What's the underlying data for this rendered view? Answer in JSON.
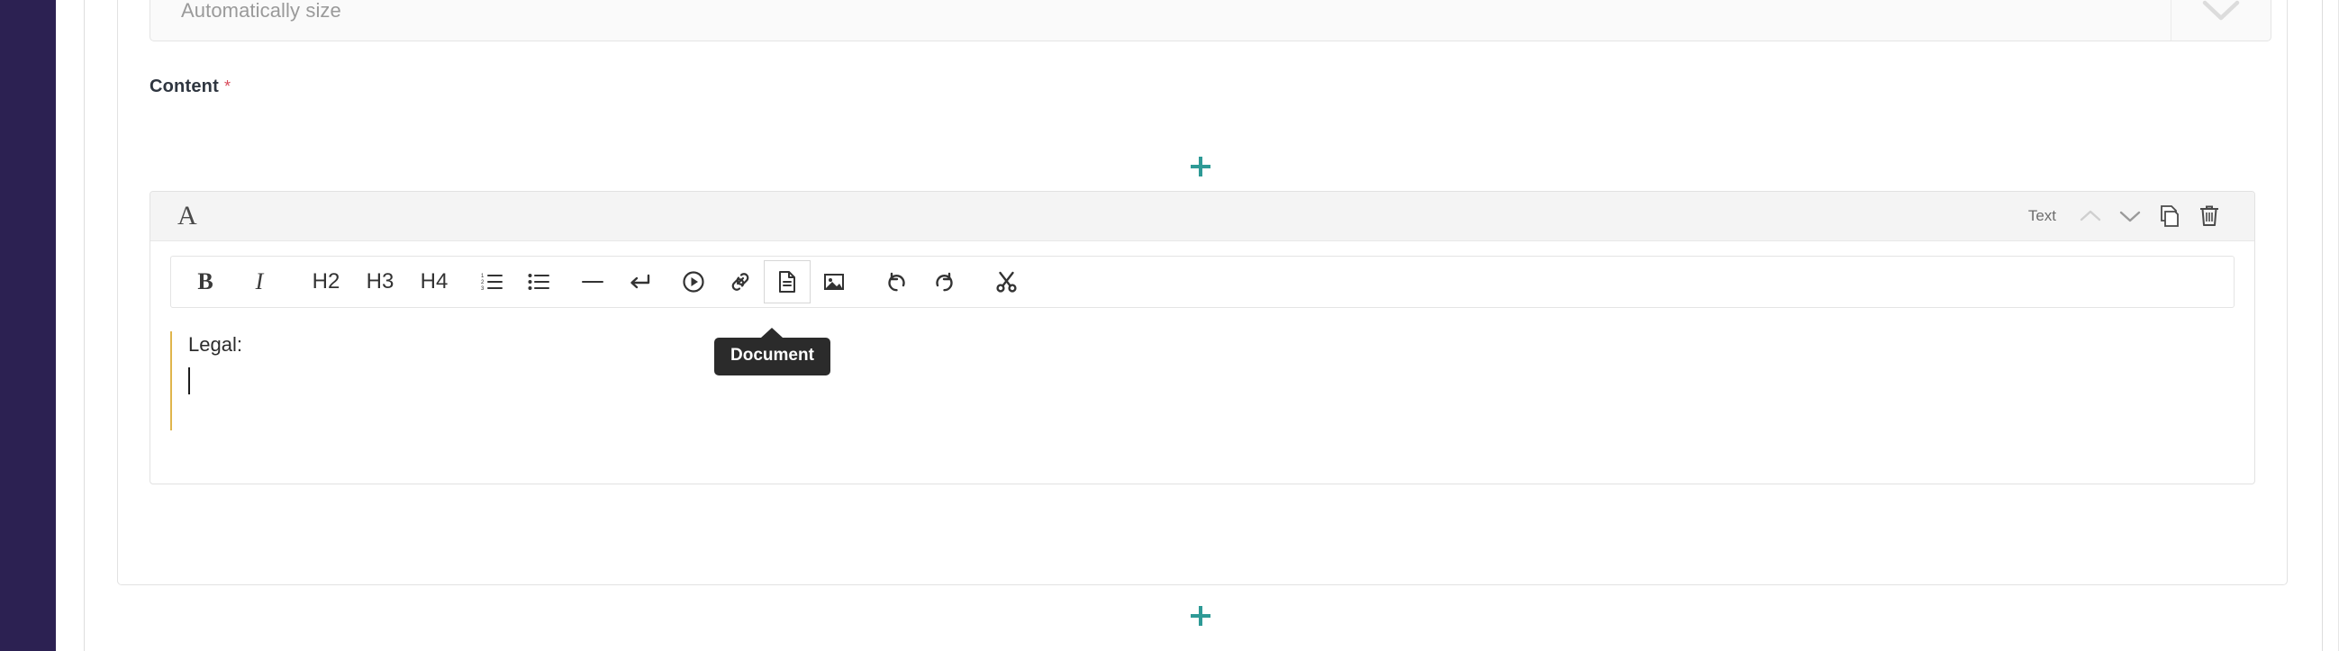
{
  "theme": {
    "sidebar_color": "#2c2152",
    "accent_color": "#2e9a96",
    "required_color": "#d94a5a",
    "tooltip_bg": "#2b2b2b",
    "block_header_bg": "#f4f4f4",
    "editor_quote_border": "#e0b54c"
  },
  "size_field": {
    "name": "size-select",
    "placeholder": "Automatically size",
    "value": "Automatically size",
    "chevron_icon": "chevron-down-icon"
  },
  "content_section": {
    "label": "Content",
    "required_marker": "*"
  },
  "add_buttons": [
    {
      "name": "add-block-top",
      "icon": "plus-icon",
      "label": "+"
    },
    {
      "name": "add-block-middle",
      "icon": "plus-icon",
      "label": "+"
    },
    {
      "name": "add-block-bottom",
      "icon": "plus-icon",
      "label": "+"
    }
  ],
  "text_block": {
    "type_icon": "A",
    "type_icon_name": "text-block-icon",
    "type_label": "Text",
    "header_actions": [
      {
        "name": "move-block-up-button",
        "icon": "chevron-up-icon",
        "disabled": true
      },
      {
        "name": "move-block-down-button",
        "icon": "chevron-down-icon",
        "disabled": false
      },
      {
        "name": "duplicate-block-button",
        "icon": "copy-icon",
        "disabled": false
      },
      {
        "name": "delete-block-button",
        "icon": "trash-icon",
        "disabled": false
      }
    ],
    "toolbar": [
      {
        "name": "bold-button",
        "icon": "bold-icon",
        "label": "B",
        "kind": "letter-b",
        "active": false
      },
      {
        "name": "italic-button",
        "icon": "italic-icon",
        "label": "I",
        "kind": "letter-i",
        "active": false
      },
      {
        "name": "heading-2-button",
        "icon": "h2-icon",
        "label": "H2",
        "kind": "letter-h",
        "active": false
      },
      {
        "name": "heading-3-button",
        "icon": "h3-icon",
        "label": "H3",
        "kind": "letter-h",
        "active": false
      },
      {
        "name": "heading-4-button",
        "icon": "h4-icon",
        "label": "H4",
        "kind": "letter-h",
        "active": false
      },
      {
        "name": "ordered-list-button",
        "icon": "ordered-list-icon",
        "label": "",
        "kind": "svg",
        "active": false
      },
      {
        "name": "bullet-list-button",
        "icon": "bullet-list-icon",
        "label": "",
        "kind": "svg",
        "active": false
      },
      {
        "name": "horizontal-rule-button",
        "icon": "horizontal-rule-icon",
        "label": "",
        "kind": "svg",
        "active": false
      },
      {
        "name": "line-break-button",
        "icon": "line-break-icon",
        "label": "",
        "kind": "svg",
        "active": false
      },
      {
        "name": "video-button",
        "icon": "play-circle-icon",
        "label": "",
        "kind": "svg",
        "active": false
      },
      {
        "name": "link-button",
        "icon": "link-icon",
        "label": "",
        "kind": "svg",
        "active": false
      },
      {
        "name": "document-button",
        "icon": "document-icon",
        "label": "",
        "kind": "svg",
        "active": true
      },
      {
        "name": "image-button",
        "icon": "image-icon",
        "label": "",
        "kind": "svg",
        "active": false
      },
      {
        "name": "undo-button",
        "icon": "undo-icon",
        "label": "",
        "kind": "svg",
        "active": false
      },
      {
        "name": "redo-button",
        "icon": "redo-icon",
        "label": "",
        "kind": "svg",
        "active": false
      },
      {
        "name": "cut-button",
        "icon": "scissors-icon",
        "label": "",
        "kind": "svg",
        "active": false
      }
    ],
    "tooltip": {
      "text": "Document",
      "target": "document-button"
    },
    "content": {
      "line_1": "Legal:",
      "caret_visible": true
    }
  }
}
